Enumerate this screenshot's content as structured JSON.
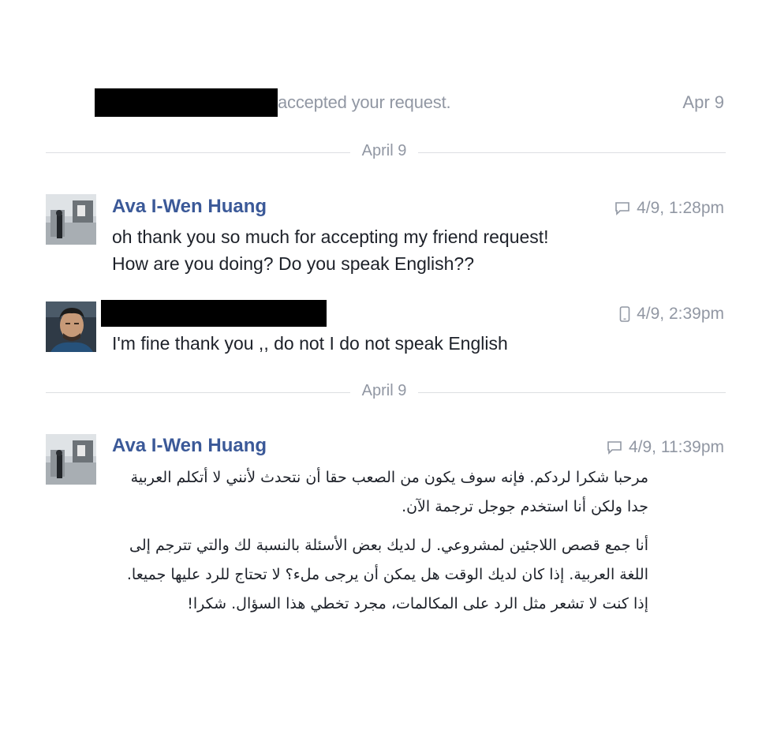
{
  "notice": {
    "text": "accepted your request.",
    "date": "Apr 9"
  },
  "dividers": [
    "April 9",
    "April 9"
  ],
  "messages": [
    {
      "sender": "Ava I-Wen Huang",
      "timestamp": "4/9, 1:28pm",
      "source_icon": "chat-bubble-icon",
      "lines": [
        "oh thank you so much for accepting my friend request!",
        "How are you doing? Do you speak English??"
      ]
    },
    {
      "sender": "",
      "timestamp": "4/9, 2:39pm",
      "source_icon": "mobile-phone-icon",
      "lines": [
        "I'm fine thank you ,, do not I do not speak English"
      ]
    },
    {
      "sender": "Ava I-Wen Huang",
      "timestamp": "4/9, 11:39pm",
      "source_icon": "chat-bubble-icon",
      "paragraphs": [
        "مرحبا شكرا لردكم. فإنه سوف يكون من الصعب حقا أن نتحدث لأنني لا أتكلم العربية جدا ولكن أنا استخدم جوجل ترجمة الآن.",
        "أنا جمع قصص اللاجئين لمشروعي. ل لديك بعض الأسئلة بالنسبة لك والتي تترجم إلى اللغة العربية. إذا كان لديك الوقت هل يمكن أن يرجى ملء؟ لا تحتاج للرد عليها جميعا. إذا كنت لا تشعر مثل الرد على المكالمات، مجرد تخطي هذا السؤال. شكرا!"
      ]
    }
  ],
  "colors": {
    "sender_name": "#3b5998",
    "meta_text": "#9197a3",
    "body_text": "#1d2129",
    "divider": "#dddfe2"
  }
}
